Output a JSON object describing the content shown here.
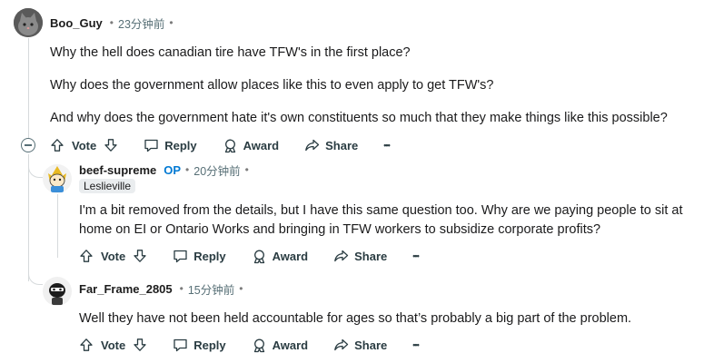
{
  "comments": [
    {
      "username": "Boo_Guy",
      "timestamp": "23分钟前",
      "paragraphs": [
        "Why the hell does canadian tire have TFW's in the first place?",
        "Why does the government allow places like this to even apply to get TFW's?",
        "And why does the government hate it's own constituents so much that they make things like this possible?"
      ],
      "actions": {
        "vote": "Vote",
        "reply": "Reply",
        "award": "Award",
        "share": "Share",
        "more": "•••"
      }
    },
    {
      "username": "beef-supreme",
      "op_badge": "OP",
      "timestamp": "20分钟前",
      "flair": "Leslieville",
      "paragraphs": [
        "I'm a bit removed from the details, but I have this same question too. Why are we paying people to sit at",
        "home on EI or Ontario Works and bringing in TFW workers to subsidize corporate profits?"
      ],
      "actions": {
        "vote": "Vote",
        "reply": "Reply",
        "award": "Award",
        "share": "Share",
        "more": "•••"
      }
    },
    {
      "username": "Far_Frame_2805",
      "timestamp": "15分钟前",
      "paragraphs": [
        "Well they have not been held accountable for ages so that’s probably a big part of the problem."
      ],
      "actions": {
        "vote": "Vote",
        "reply": "Reply",
        "award": "Award",
        "share": "Share",
        "more": "•••"
      }
    }
  ],
  "separator_dot": "•"
}
